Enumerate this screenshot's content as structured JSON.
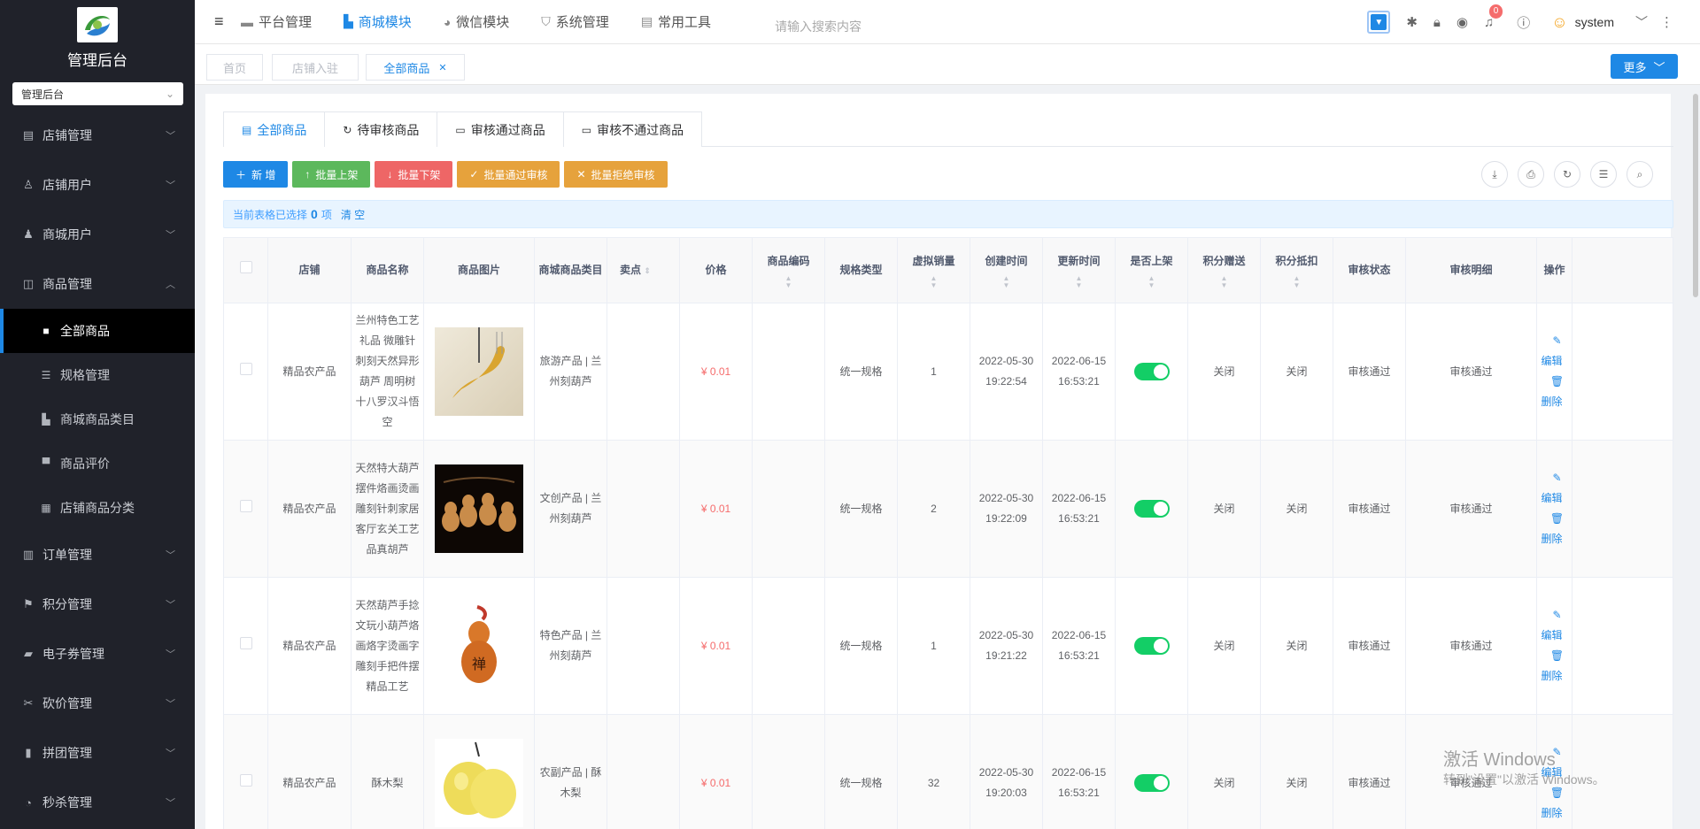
{
  "app": {
    "title": "管理后台",
    "system_select": "管理后台"
  },
  "sidebar": {
    "items": [
      {
        "label": "店铺管理",
        "icon": "shop-icon"
      },
      {
        "label": "店铺用户",
        "icon": "user-icon"
      },
      {
        "label": "商城用户",
        "icon": "user-filled-icon"
      },
      {
        "label": "商品管理",
        "icon": "bag-icon",
        "expanded": true
      }
    ],
    "sub_items": [
      {
        "label": "全部商品",
        "icon": "lock-icon",
        "active": true
      },
      {
        "label": "规格管理",
        "icon": "sliders-icon"
      },
      {
        "label": "商城商品类目",
        "icon": "category-icon"
      },
      {
        "label": "商品评价",
        "icon": "comment-icon"
      },
      {
        "label": "店铺商品分类",
        "icon": "box-icon"
      }
    ],
    "items_after": [
      {
        "label": "订单管理",
        "icon": "order-icon"
      },
      {
        "label": "积分管理",
        "icon": "flag-icon"
      },
      {
        "label": "电子券管理",
        "icon": "ticket-icon"
      },
      {
        "label": "砍价管理",
        "icon": "cut-icon"
      },
      {
        "label": "拼团管理",
        "icon": "group-icon"
      },
      {
        "label": "秒杀管理",
        "icon": "timer-icon"
      }
    ]
  },
  "header": {
    "nav": [
      {
        "label": "平台管理",
        "icon": "monitor-icon",
        "active": false
      },
      {
        "label": "商城模块",
        "icon": "shop-icon",
        "active": true
      },
      {
        "label": "微信模块",
        "icon": "wechat-icon",
        "active": false
      },
      {
        "label": "系统管理",
        "icon": "shield-icon",
        "active": false
      },
      {
        "label": "常用工具",
        "icon": "toolbox-icon",
        "active": false
      }
    ],
    "search_placeholder": "请输入搜索内容",
    "notification_count": "0",
    "username": "system"
  },
  "tags": {
    "items": [
      "首页",
      "店铺入驻",
      "全部商品"
    ],
    "more_label": "更多"
  },
  "tabs": [
    "全部商品",
    "待审核商品",
    "审核通过商品",
    "审核不通过商品"
  ],
  "toolbar": {
    "add": "新 增",
    "batch_on": "批量上架",
    "batch_off": "批量下架",
    "batch_approve": "批量通过审核",
    "batch_reject": "批量拒绝审核"
  },
  "selection": {
    "prefix": "当前表格已选择",
    "count": "0",
    "suffix": "项",
    "clear": "清 空"
  },
  "table": {
    "headers": [
      "店铺",
      "商品名称",
      "商品图片",
      "商城商品类目",
      "卖点",
      "价格",
      "商品编码",
      "规格类型",
      "虚拟销量",
      "创建时间",
      "更新时间",
      "是否上架",
      "积分赠送",
      "积分抵扣",
      "审核状态",
      "审核明细",
      "操作"
    ],
    "edit_label": "编辑",
    "delete_label": "删除",
    "rows": [
      {
        "shop": "精品农产品",
        "name": "兰州特色工艺礼品 微雕针刺刻天然异形葫芦 周明树十八罗汉斗悟空",
        "category": "旅游产品 | 兰州刻葫芦",
        "selling_point": "",
        "price": "¥ 0.01",
        "code": "",
        "spec": "统一规格",
        "sales": "1",
        "created": "2022-05-30 19:22:54",
        "updated": "2022-06-15 16:53:21",
        "on_sale": true,
        "points_gift": "关闭",
        "points_deduct": "关闭",
        "audit_status": "审核通过",
        "audit_detail": "审核通过"
      },
      {
        "shop": "精品农产品",
        "name": "天然特大葫芦摆件烙画烫画雕刻针刺家居客厅玄关工艺品真胡芦",
        "category": "文创产品 | 兰州刻葫芦",
        "selling_point": "",
        "price": "¥ 0.01",
        "code": "",
        "spec": "统一规格",
        "sales": "2",
        "created": "2022-05-30 19:22:09",
        "updated": "2022-06-15 16:53:21",
        "on_sale": true,
        "points_gift": "关闭",
        "points_deduct": "关闭",
        "audit_status": "审核通过",
        "audit_detail": "审核通过"
      },
      {
        "shop": "精品农产品",
        "name": "天然葫芦手捻文玩小葫芦烙画烙字烫画字雕刻手把件摆精品工艺",
        "category": "特色产品 | 兰州刻葫芦",
        "selling_point": "",
        "price": "¥ 0.01",
        "code": "",
        "spec": "统一规格",
        "sales": "1",
        "created": "2022-05-30 19:21:22",
        "updated": "2022-06-15 16:53:21",
        "on_sale": true,
        "points_gift": "关闭",
        "points_deduct": "关闭",
        "audit_status": "审核通过",
        "audit_detail": "审核通过"
      },
      {
        "shop": "精品农产品",
        "name": "酥木梨",
        "category": "农副产品 | 酥木梨",
        "selling_point": "",
        "price": "¥ 0.01",
        "code": "",
        "spec": "统一规格",
        "sales": "32",
        "created": "2022-05-30 19:20:03",
        "updated": "2022-06-15 16:53:21",
        "on_sale": true,
        "points_gift": "关闭",
        "points_deduct": "关闭",
        "audit_status": "审核通过",
        "audit_detail": "审核通过"
      }
    ]
  },
  "watermark": {
    "line1": "激活 Windows",
    "line2": "转到\"设置\"以激活 Windows。"
  }
}
